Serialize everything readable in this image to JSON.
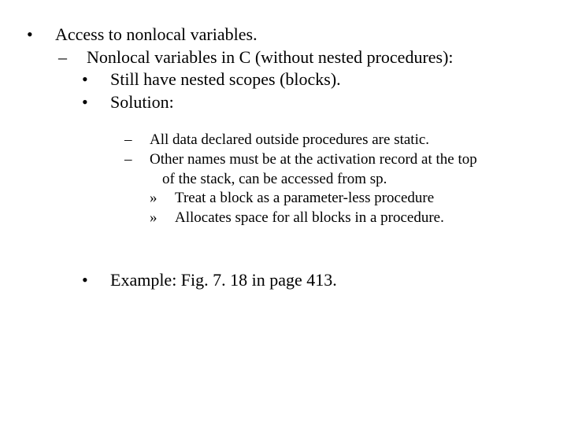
{
  "bullets": {
    "disc": "•",
    "endash": "–",
    "raquo": "»"
  },
  "content": {
    "l1_access": "Access to nonlocal variables.",
    "l2_nonlocal": "Nonlocal variables in C (without nested procedures):",
    "l3_still": "Still have nested scopes (blocks).",
    "l3_solution": "Solution:",
    "l4_static": "All data declared outside procedures are static.",
    "l4_other": "Other names must be at the activation record at the top of the stack, can be accessed from sp.",
    "l5_treat": "Treat a block as a parameter-less procedure",
    "l5_alloc": "Allocates space for all blocks in a procedure.",
    "l3_example": "Example: Fig. 7. 18 in page 413."
  }
}
